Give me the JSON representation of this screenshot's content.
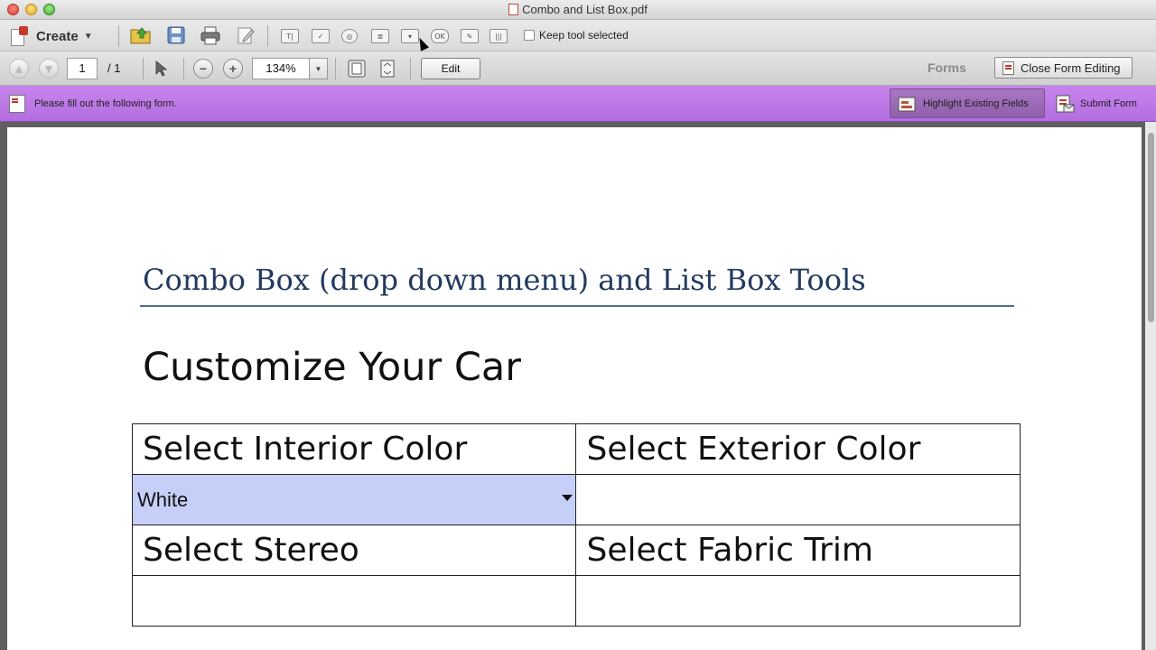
{
  "window": {
    "title": "Combo and List Box.pdf"
  },
  "toolbar1": {
    "create_label": "Create",
    "keep_tool_label": "Keep tool selected",
    "form_tools": [
      {
        "icon": "text-field-icon",
        "glyph": "T|"
      },
      {
        "icon": "checkbox-tool-icon",
        "glyph": "✓"
      },
      {
        "icon": "radio-button-tool-icon",
        "glyph": "◎"
      },
      {
        "icon": "list-box-tool-icon",
        "glyph": "≣"
      },
      {
        "icon": "combo-box-tool-icon",
        "glyph": "▾"
      },
      {
        "icon": "button-tool-icon",
        "glyph": "OK"
      },
      {
        "icon": "digital-signature-tool-icon",
        "glyph": "✎"
      },
      {
        "icon": "barcode-tool-icon",
        "glyph": "|||"
      }
    ]
  },
  "toolbar2": {
    "page_current": "1",
    "page_total": "/ 1",
    "zoom": "134%",
    "edit_label": "Edit",
    "forms_label": "Forms",
    "close_form_label": "Close Form Editing"
  },
  "formbar": {
    "message": "Please fill out the following form.",
    "highlight_label": "Highlight Existing Fields",
    "submit_label": "Submit Form",
    "color": "#b97ae3"
  },
  "document": {
    "heading": "Combo Box (drop down menu) and List Box Tools",
    "subheading": "Customize Your Car",
    "table": {
      "interior_label": "Select Interior Color",
      "exterior_label": "Select Exterior Color",
      "interior_value": "White",
      "stereo_label": "Select Stereo",
      "fabric_label": "Select Fabric Trim"
    }
  }
}
